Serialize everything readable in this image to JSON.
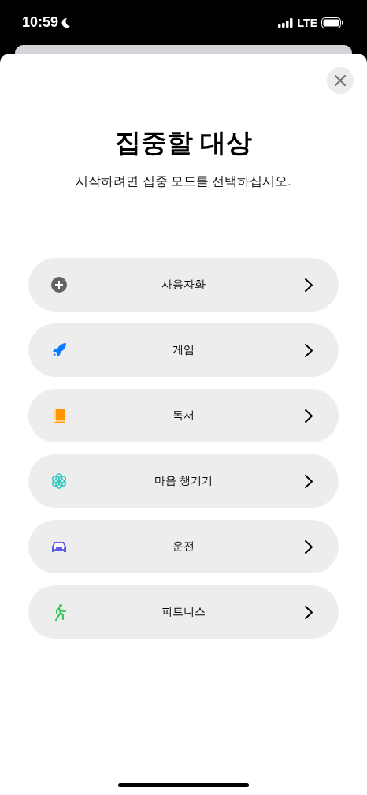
{
  "status_bar": {
    "time": "10:59",
    "network": "LTE"
  },
  "title": "집중할 대상",
  "subtitle": "시작하려면 집중 모드를 선택하십시오.",
  "modes": [
    {
      "kind": "plus",
      "label": "사용자화",
      "color": "#636366"
    },
    {
      "kind": "rocket",
      "label": "게임",
      "color": "#0a7aff"
    },
    {
      "kind": "book",
      "label": "독서",
      "color": "#ff9500"
    },
    {
      "kind": "flower",
      "label": "마음 챙기기",
      "color": "#30c8c0"
    },
    {
      "kind": "car",
      "label": "운전",
      "color": "#5e5ce6"
    },
    {
      "kind": "runner",
      "label": "피트니스",
      "color": "#34c759"
    }
  ]
}
